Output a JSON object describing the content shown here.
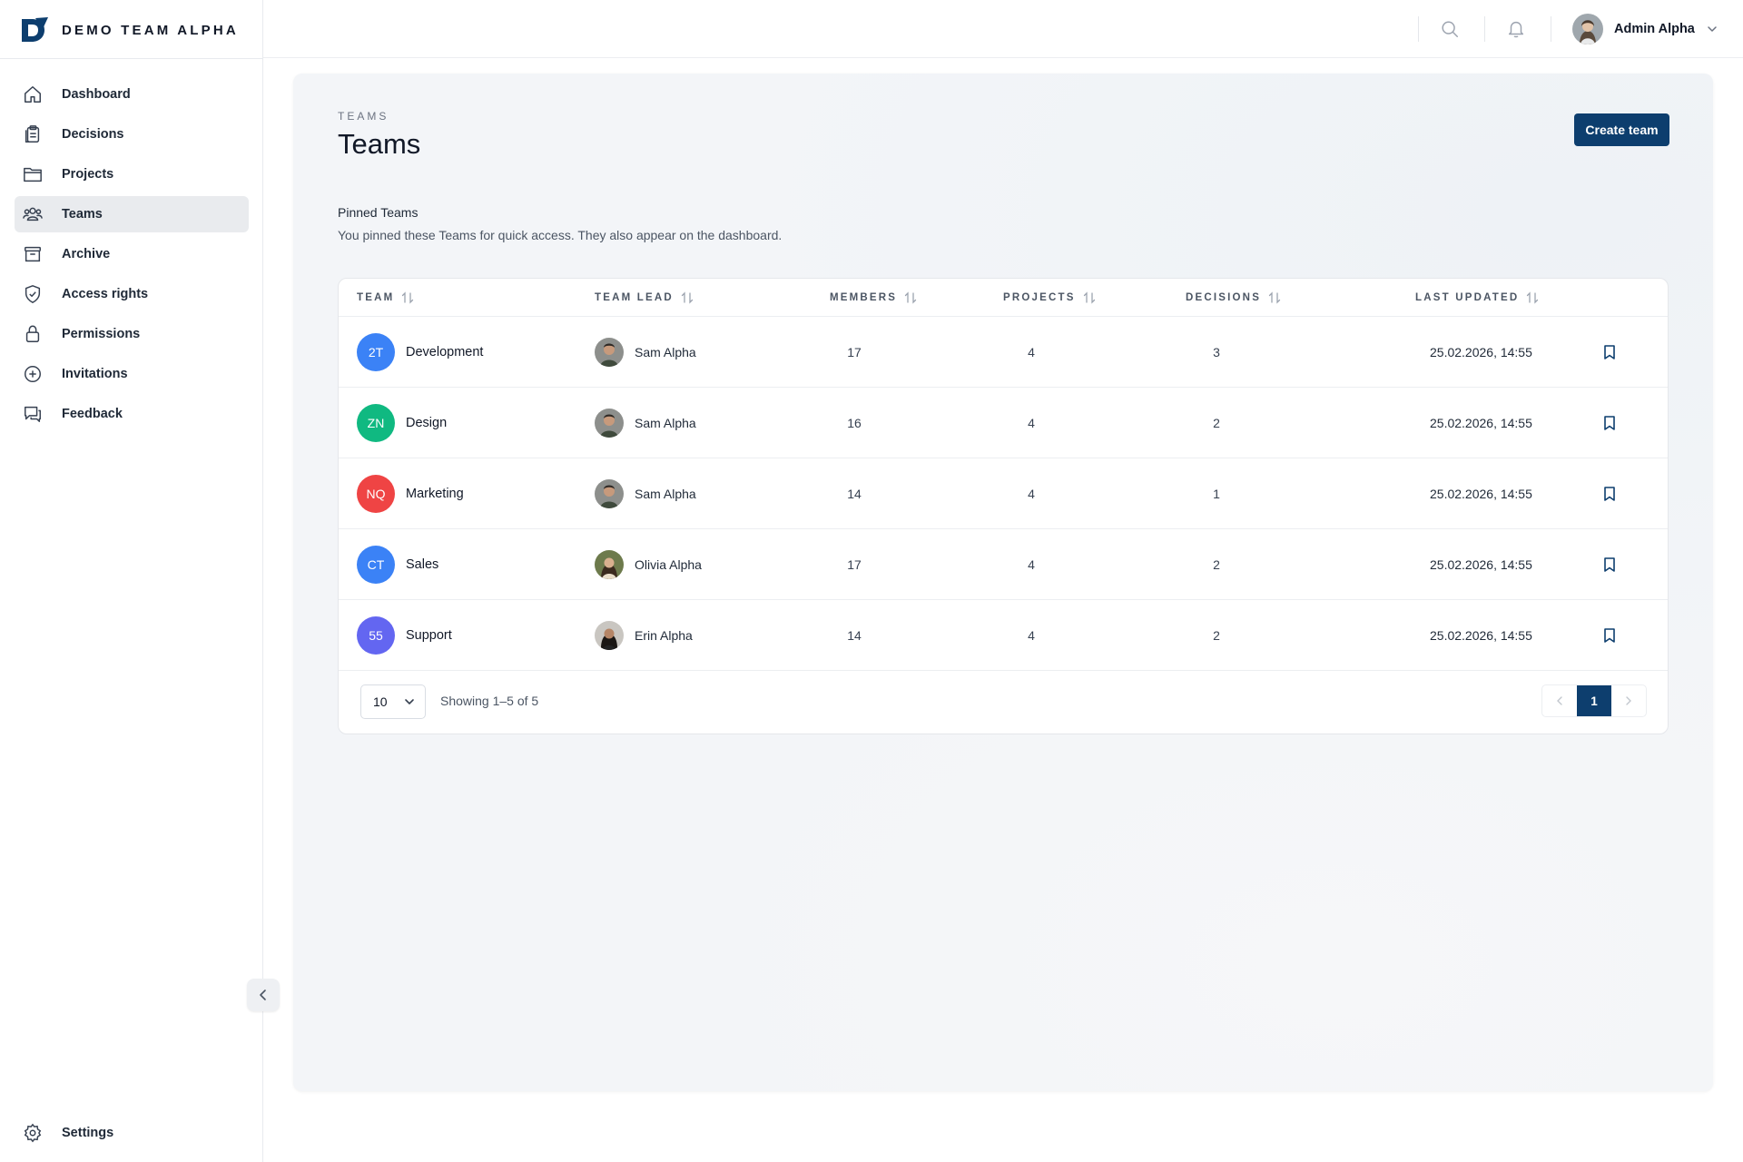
{
  "brand": {
    "name": "DEMO TEAM ALPHA",
    "accent": "#0d3e6e"
  },
  "sidebar": {
    "items": [
      {
        "label": "Dashboard",
        "icon": "home-icon"
      },
      {
        "label": "Decisions",
        "icon": "clipboard-icon"
      },
      {
        "label": "Projects",
        "icon": "folder-icon"
      },
      {
        "label": "Teams",
        "icon": "users-icon",
        "active": true
      },
      {
        "label": "Archive",
        "icon": "archive-icon"
      },
      {
        "label": "Access rights",
        "icon": "shield-icon"
      },
      {
        "label": "Permissions",
        "icon": "lock-icon"
      },
      {
        "label": "Invitations",
        "icon": "plus-circle-icon"
      },
      {
        "label": "Feedback",
        "icon": "chat-icon"
      }
    ],
    "settings_label": "Settings"
  },
  "header": {
    "user_name": "Admin Alpha"
  },
  "page": {
    "eyebrow": "TEAMS",
    "title": "Teams",
    "create_button": "Create team",
    "pinned_title": "Pinned Teams",
    "pinned_description": "You pinned these Teams for quick access. They also appear on the dashboard."
  },
  "table": {
    "columns": [
      "TEAM",
      "TEAM LEAD",
      "MEMBERS",
      "PROJECTS",
      "DECISIONS",
      "LAST UPDATED"
    ],
    "rows": [
      {
        "initials": "2T",
        "color": "#3b82f6",
        "team": "Development",
        "lead": "Sam Alpha",
        "members": "17",
        "projects": "4",
        "decisions": "3",
        "updated": "25.02.2026, 14:55"
      },
      {
        "initials": "ZN",
        "color": "#10b981",
        "team": "Design",
        "lead": "Sam Alpha",
        "members": "16",
        "projects": "4",
        "decisions": "2",
        "updated": "25.02.2026, 14:55"
      },
      {
        "initials": "NQ",
        "color": "#ef4444",
        "team": "Marketing",
        "lead": "Sam Alpha",
        "members": "14",
        "projects": "4",
        "decisions": "1",
        "updated": "25.02.2026, 14:55"
      },
      {
        "initials": "CT",
        "color": "#3b82f6",
        "team": "Sales",
        "lead": "Olivia Alpha",
        "members": "17",
        "projects": "4",
        "decisions": "2",
        "updated": "25.02.2026, 14:55"
      },
      {
        "initials": "55",
        "color": "#6366f1",
        "team": "Support",
        "lead": "Erin Alpha",
        "members": "14",
        "projects": "4",
        "decisions": "2",
        "updated": "25.02.2026, 14:55"
      }
    ],
    "page_size": "10",
    "showing": "Showing 1–5 of 5",
    "current_page": "1"
  }
}
